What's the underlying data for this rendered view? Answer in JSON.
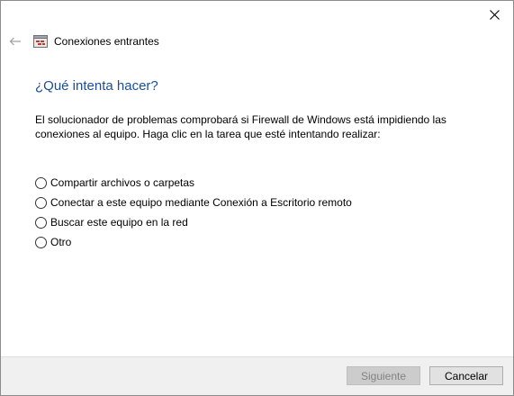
{
  "window": {
    "title": "Conexiones entrantes"
  },
  "icons": {
    "close": "close-icon",
    "back": "back-arrow-icon",
    "app": "firewall-troubleshooter-icon"
  },
  "main": {
    "heading": "¿Qué intenta hacer?",
    "description": "El solucionador de problemas comprobará si Firewall de Windows está impidiendo las conexiones al equipo. Haga clic en la tarea que esté intentando realizar:",
    "options": [
      {
        "label": "Compartir archivos o carpetas",
        "selected": false
      },
      {
        "label": "Conectar a este equipo mediante Conexión a Escritorio remoto",
        "selected": false
      },
      {
        "label": "Buscar este equipo en la red",
        "selected": false
      },
      {
        "label": "Otro",
        "selected": false
      }
    ]
  },
  "footer": {
    "next_label": "Siguiente",
    "next_enabled": false,
    "cancel_label": "Cancelar"
  },
  "colors": {
    "heading": "#1a4e9a",
    "footer_bg": "#f0f0f0",
    "disabled_text": "#838383"
  }
}
